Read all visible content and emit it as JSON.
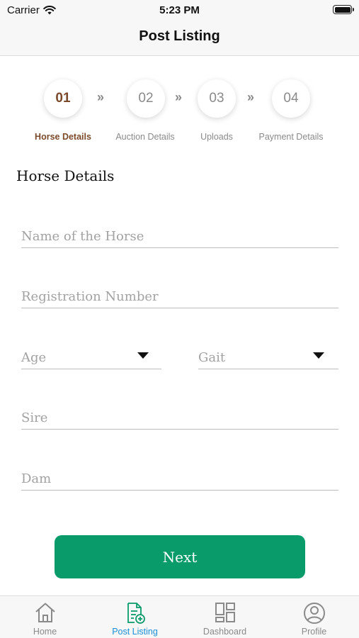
{
  "status_bar": {
    "carrier": "Carrier",
    "time": "5:23 PM"
  },
  "nav": {
    "title": "Post Listing"
  },
  "steps": [
    {
      "number": "01",
      "label": "Horse Details",
      "active": true
    },
    {
      "number": "02",
      "label": "Auction Details",
      "active": false
    },
    {
      "number": "03",
      "label": "Uploads",
      "active": false
    },
    {
      "number": "04",
      "label": "Payment Details",
      "active": false
    }
  ],
  "step_separator": "»",
  "section": {
    "title": "Horse Details"
  },
  "form": {
    "name_placeholder": "Name of the Horse",
    "registration_placeholder": "Registration Number",
    "age_placeholder": "Age",
    "gait_placeholder": "Gait",
    "sire_placeholder": "Sire",
    "dam_placeholder": "Dam"
  },
  "next_label": "Next",
  "tabs": [
    {
      "label": "Home",
      "icon": "home-icon"
    },
    {
      "label": "Post Listing",
      "icon": "post-listing-icon",
      "active": true
    },
    {
      "label": "Dashboard",
      "icon": "dashboard-icon"
    },
    {
      "label": "Profile",
      "icon": "profile-icon"
    }
  ],
  "colors": {
    "accent_green": "#0a9b6b",
    "active_step": "#7a4a2a",
    "active_tab": "#1a8fd6"
  }
}
